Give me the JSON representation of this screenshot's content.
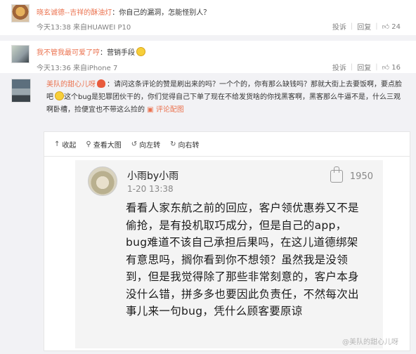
{
  "comments": [
    {
      "name": "晓玄诚德--吉祥的酥油灯",
      "text": "：你自己的漏洞，怎能怪别人？",
      "time": "今天13:38",
      "source": "来自HUAWEI P10",
      "report": "投诉",
      "reply": "回复",
      "likes": "24"
    },
    {
      "name": "我不管我最可爱了哼",
      "text": "：营销手段",
      "time": "今天13:36",
      "source": "来自iPhone 7",
      "report": "投诉",
      "reply": "回复",
      "likes": "16"
    }
  ],
  "main_comment": {
    "name": "美队的甜心儿呀",
    "text_a": "：请问这条评论的赞是刷出来的吗？一个个的，你有那么缺钱吗？那就大街上去要饭啊，要点脸吧",
    "text_b": "这个bug是犯罪团伙干的，你们觉得自己下单了现在不给发货啥的你找黑客啊，黑客那么牛逼不是，什么三观啊卧槽，捡便宜也不带这么捡的",
    "gif_link": "评论配图"
  },
  "toolbar": {
    "collapse": "收起",
    "view_large": "查看大图",
    "rotate_left": "向左转",
    "rotate_right": "向右转"
  },
  "image_card": {
    "name": "小雨by小雨",
    "time": "1-20 13:38",
    "likes": "1950",
    "text": "看看人家东航之前的回应，客户领优惠券又不是偷抢，是有投机取巧成分，但是自己的app，bug难道不该自己承担后果吗，在这儿道德绑架有意思吗，搁你看到你不想领？虽然我是没领到，但是我觉得除了那些非常刻意的，客户本身没什么错，拼多多也要因此负责任，不然每次出事儿来一句bug，凭什么顾客要原谅",
    "watermark": "@美队的甜心儿呀"
  }
}
